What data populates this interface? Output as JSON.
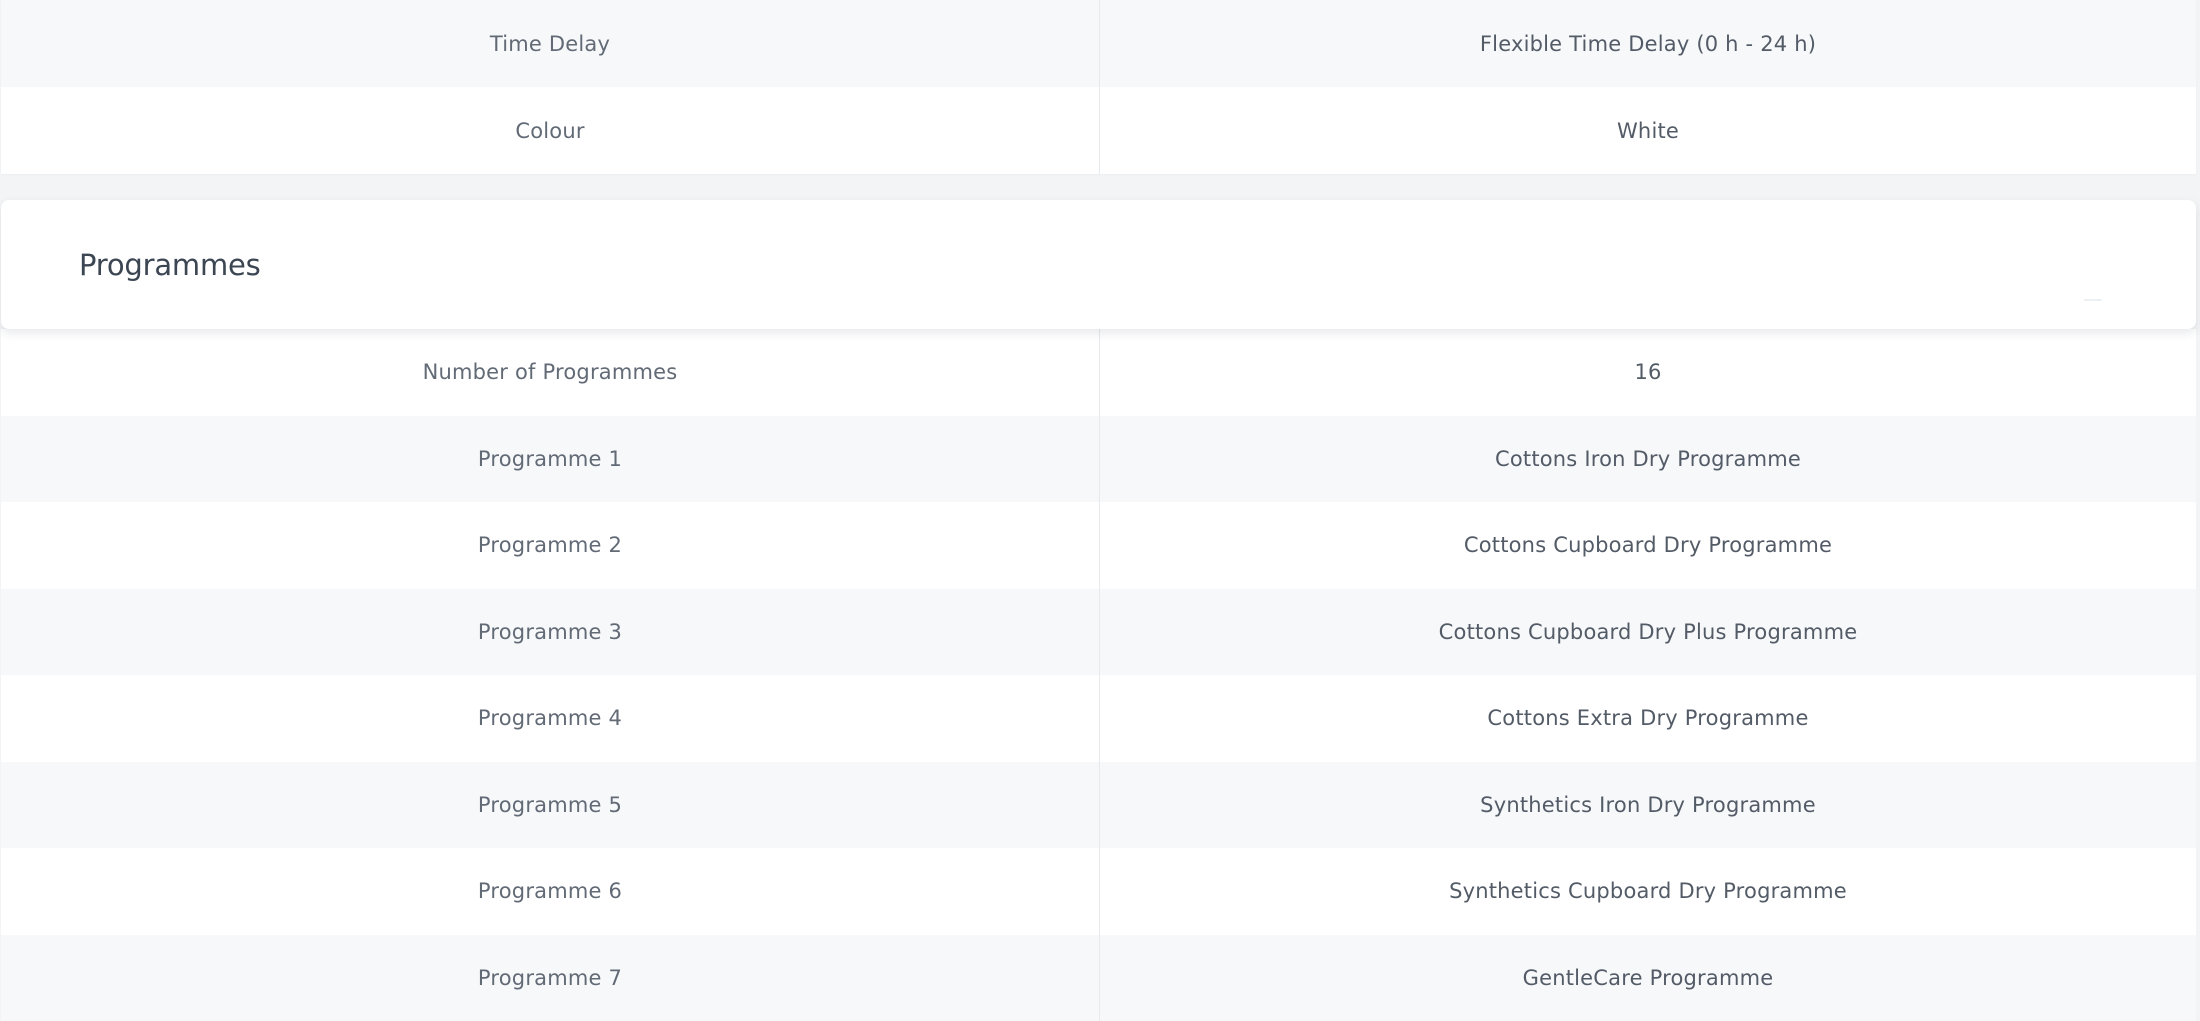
{
  "top_table": {
    "rows": [
      {
        "label": "Time Delay",
        "value": "Flexible Time Delay (0 h - 24 h)"
      },
      {
        "label": "Colour",
        "value": "White"
      }
    ]
  },
  "programmes_section": {
    "title": "Programmes",
    "rows": [
      {
        "label": "Number of Programmes",
        "value": "16"
      },
      {
        "label": "Programme 1",
        "value": "Cottons Iron Dry Programme"
      },
      {
        "label": "Programme 2",
        "value": "Cottons Cupboard Dry Programme"
      },
      {
        "label": "Programme 3",
        "value": "Cottons Cupboard Dry Plus Programme"
      },
      {
        "label": "Programme 4",
        "value": "Cottons Extra Dry Programme"
      },
      {
        "label": "Programme 5",
        "value": "Synthetics Iron Dry Programme"
      },
      {
        "label": "Programme 6",
        "value": "Synthetics Cupboard Dry Programme"
      },
      {
        "label": "Programme 7",
        "value": "GentleCare Programme"
      }
    ]
  },
  "colors": {
    "page_background": "#f3f4f6",
    "row_alt_background": "#f7f8fa",
    "text": "#5d6672",
    "title_text": "#3c4653"
  },
  "icons": {
    "section_toggle": "collapse-toggle-icon"
  }
}
